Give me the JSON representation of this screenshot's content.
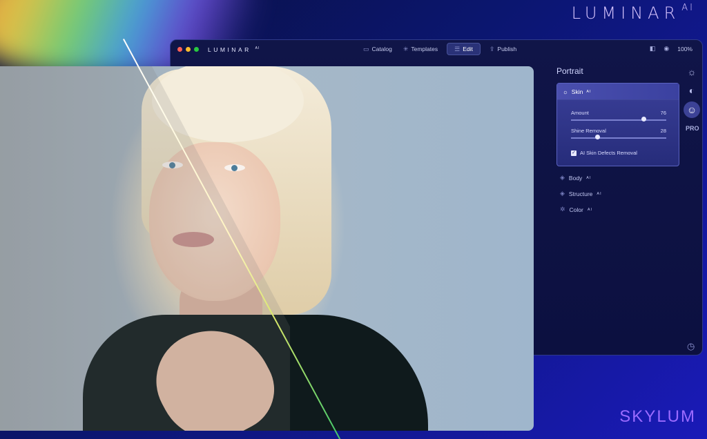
{
  "brand": {
    "name": "LUMINAR",
    "suffix": "AI",
    "footer": "SKYLUM"
  },
  "window": {
    "logo": "LUMINAR",
    "logo_suffix": "AI",
    "traffic_lights": [
      "#ff5f57",
      "#ffbd2e",
      "#28c840"
    ],
    "nav": [
      {
        "label": "Catalog",
        "icon": "folder-icon"
      },
      {
        "label": "Templates",
        "icon": "sparkle-icon"
      },
      {
        "label": "Edit",
        "icon": "sliders-icon",
        "active": true
      },
      {
        "label": "Publish",
        "icon": "share-icon"
      }
    ],
    "zoom": "100%"
  },
  "panel": {
    "title": "Portrait",
    "skin": {
      "label": "Skin",
      "ai": "AI",
      "amount_label": "Amount",
      "amount_value": 76,
      "shine_label": "Shine Removal",
      "shine_value": 28,
      "defects_label": "AI Skin Defects Removal",
      "defects_checked": true
    },
    "tools": [
      {
        "label": "Body",
        "ai": "AI",
        "icon": "body-icon"
      },
      {
        "label": "Structure",
        "ai": "AI",
        "icon": "structure-icon"
      },
      {
        "label": "Color",
        "ai": "AI",
        "icon": "color-icon"
      }
    ],
    "side": [
      "sun-icon",
      "palette-icon",
      "face-icon",
      "PRO",
      "clock-icon"
    ]
  },
  "accent": "#9b6bff"
}
